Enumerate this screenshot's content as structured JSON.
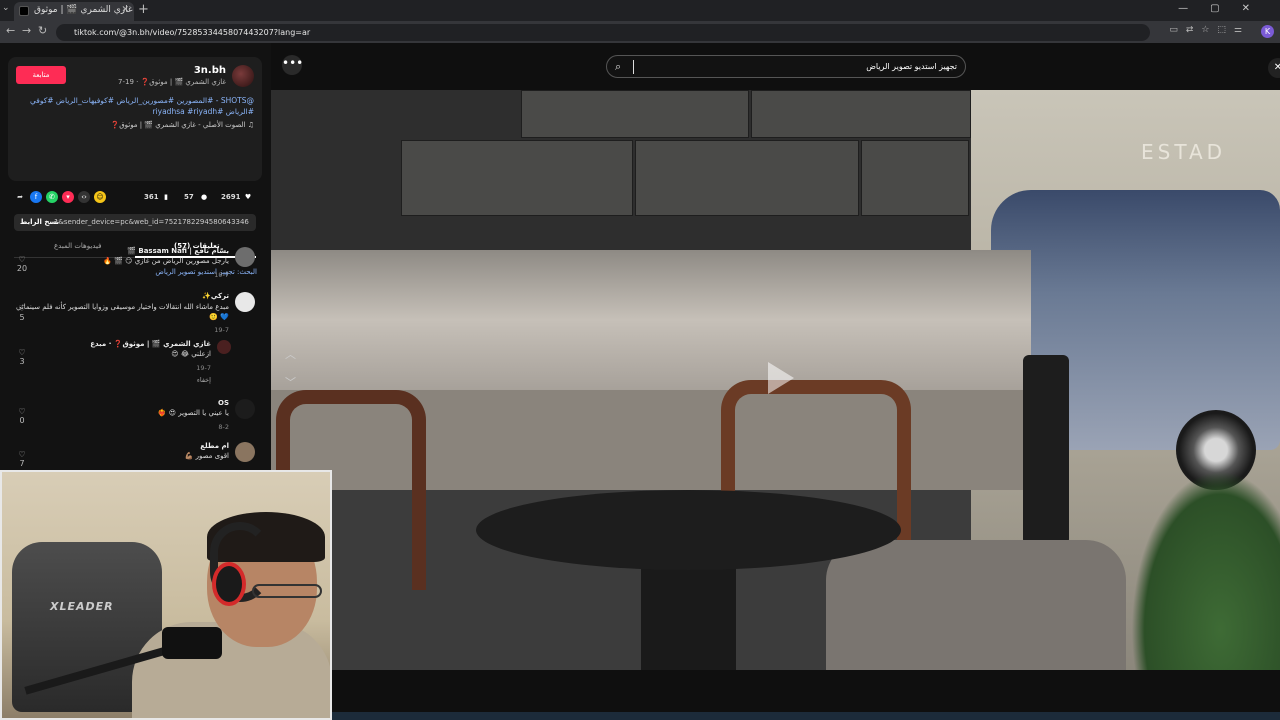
{
  "browser": {
    "tab_title": "غازي الشمري 🎬 | موثوق (@",
    "url": "tiktok.com/@3n.bh/video/7528533445807443207?lang=ar",
    "new_tab": "+",
    "close_tab": "✕"
  },
  "profile": {
    "username": "3n.bh",
    "subtitle": "غازي الشمري 🎬 | موثوق❓ · 19-7",
    "follow_label": "متابعة",
    "description": "@SHOTS - #المصورين #مصورين_الرياض #كوفيهات_الرياض #كوفي #الرياض #riyadhsa #riyadh",
    "music": "♫ الصوت الأصلي - غازي الشمري 🎬 | موثوق❓"
  },
  "actions": {
    "likes": "2691",
    "comments": "57",
    "saves": "361",
    "link_url": "1&sender_device=pc&web_id=7521782294580643346",
    "copy_label": "نسخ الرابط"
  },
  "tabs": {
    "comments": "(57) تعليقات",
    "creator_videos": "فيديوهات المبدع"
  },
  "search_hint": "البحث: تجهيز استديو تصوير الرياض",
  "comments": [
    {
      "name": "بسّام نافع | Bassam Nafi 🎬",
      "text": "يارجل مصورين الرياض من غازي 😏 🎬 🔥",
      "date": "19-7",
      "likes": "20",
      "avatar_color": "#6d6d6d"
    },
    {
      "name": "تركي✨",
      "text": "مبدع ماشاء الله انتقالات واختيار موسيقى وزوايا التصوير كأنه فلم سينمائي 💙 🙂",
      "date": "19-7",
      "likes": "5",
      "avatar_color": "#e8e8e8"
    },
    {
      "name": "غازي الشمري 🎬 | موثوق❓ · مبدع",
      "text": "ازعلني 😂 😍",
      "date": "19-7",
      "likes": "3",
      "avatar_color": "#4a2020"
    },
    {
      "name": "OS",
      "text": "يا عيني يا التصوير 😍 ❤️‍🔥",
      "date": "8-2",
      "likes": "0",
      "avatar_color": "#1c1c1c"
    },
    {
      "name": "ام مطلع",
      "text": "اقوى مصور 💪🏽",
      "date": "",
      "likes": "7",
      "avatar_color": "#8a7560"
    }
  ],
  "hide_label": "إخفاء",
  "video": {
    "search_text": "تجهيز استديو تصوير الرياض",
    "more": "•••",
    "close": "✕"
  },
  "webcam": {
    "chair_brand": "XLEADER"
  },
  "colors": {
    "follow_red": "#fe2c55",
    "link_blue": "#8ab4f8"
  }
}
